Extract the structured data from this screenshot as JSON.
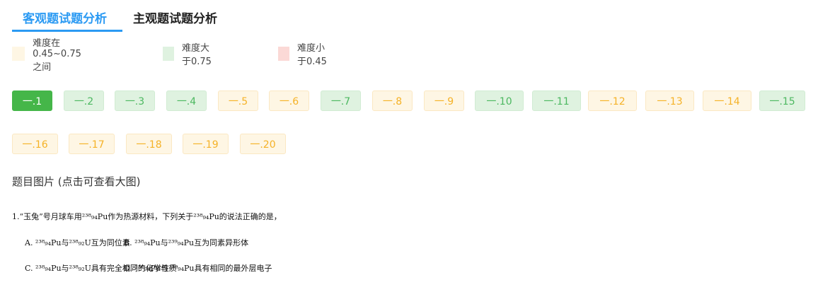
{
  "tabs": [
    {
      "label": "客观题试题分析",
      "active": true
    },
    {
      "label": "主观题试题分析",
      "active": false
    }
  ],
  "legend": [
    {
      "label": "难度在0.45~0.75之间",
      "color": "#fef6e4"
    },
    {
      "label": "难度大于0.75",
      "color": "#dff2e0"
    },
    {
      "label": "难度小于0.45",
      "color": "#fbd9d6"
    }
  ],
  "questions": [
    {
      "label": "一.1",
      "state": "active"
    },
    {
      "label": "一.2",
      "state": "green"
    },
    {
      "label": "一.3",
      "state": "green"
    },
    {
      "label": "一.4",
      "state": "green"
    },
    {
      "label": "一.5",
      "state": "yellow"
    },
    {
      "label": "一.6",
      "state": "yellow"
    },
    {
      "label": "一.7",
      "state": "green"
    },
    {
      "label": "一.8",
      "state": "yellow"
    },
    {
      "label": "一.9",
      "state": "yellow"
    },
    {
      "label": "一.10",
      "state": "green"
    },
    {
      "label": "一.11",
      "state": "green"
    },
    {
      "label": "一.12",
      "state": "yellow"
    },
    {
      "label": "一.13",
      "state": "yellow"
    },
    {
      "label": "一.14",
      "state": "yellow"
    },
    {
      "label": "一.15",
      "state": "green"
    },
    {
      "label": "一.16",
      "state": "yellow"
    },
    {
      "label": "一.17",
      "state": "yellow"
    },
    {
      "label": "一.18",
      "state": "yellow"
    },
    {
      "label": "一.19",
      "state": "yellow"
    },
    {
      "label": "一.20",
      "state": "yellow"
    }
  ],
  "image_section": {
    "title": "题目图片 (点击可查看大图)",
    "lines": [
      "1.“玉兔”号月球车用²³⁸₉₄Pu作为热源材料，下列关于²³⁸₉₄Pu的说法正确的是，",
      "A. ²³⁸₉₄Pu与²³⁸₉₂U互为同位素",
      "B. ²³⁸₉₄Pu与²³⁹₉₄Pu互为同素异形体",
      "C. ²³⁸₉₄Pu与²³⁸₉₂U具有完全相同的化学性质",
      "D. ²³⁸₉₄Pu与²³⁹₉₄Pu具有相同的最外层电子"
    ]
  }
}
